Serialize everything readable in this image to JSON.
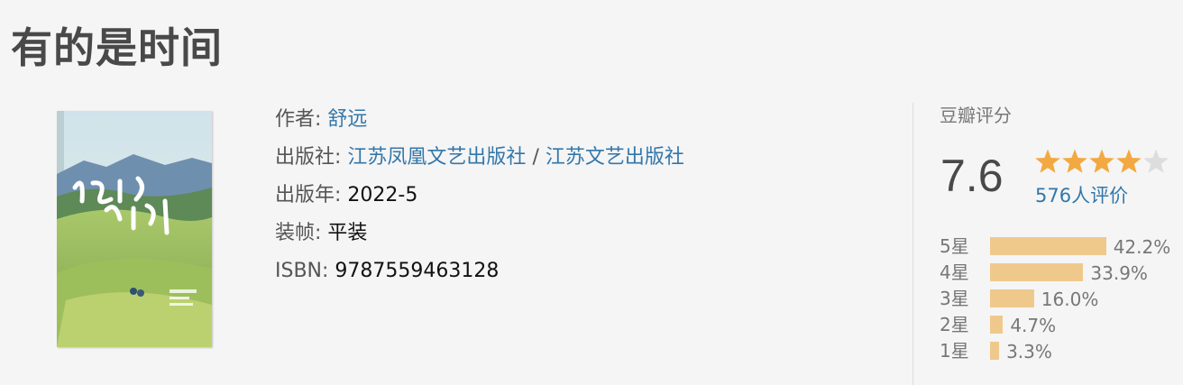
{
  "book": {
    "title": "有的是时间",
    "author_label": "作者:",
    "author": "舒远",
    "publisher_label": "出版社:",
    "publisher1": "江苏凤凰文艺出版社",
    "publisher_sep": "/",
    "publisher2": "江苏文艺出版社",
    "year_label": "出版年:",
    "year": "2022-5",
    "binding_label": "装帧:",
    "binding": "平装",
    "isbn_label": "ISBN:",
    "isbn": "9787559463128"
  },
  "rating": {
    "title": "豆瓣评分",
    "score": "7.6",
    "stars_filled": 4,
    "stars_total": 5,
    "people": "576人评价",
    "colors": {
      "star": "#f3a941",
      "star_empty": "#dddddd",
      "bar": "#efc98c",
      "link": "#3377aa"
    },
    "breakdown": [
      {
        "label": "5星",
        "percent": 42.2,
        "text": "42.2%"
      },
      {
        "label": "4星",
        "percent": 33.9,
        "text": "33.9%"
      },
      {
        "label": "3星",
        "percent": 16.0,
        "text": "16.0%"
      },
      {
        "label": "2星",
        "percent": 4.7,
        "text": "4.7%"
      },
      {
        "label": "1星",
        "percent": 3.3,
        "text": "3.3%"
      }
    ]
  }
}
